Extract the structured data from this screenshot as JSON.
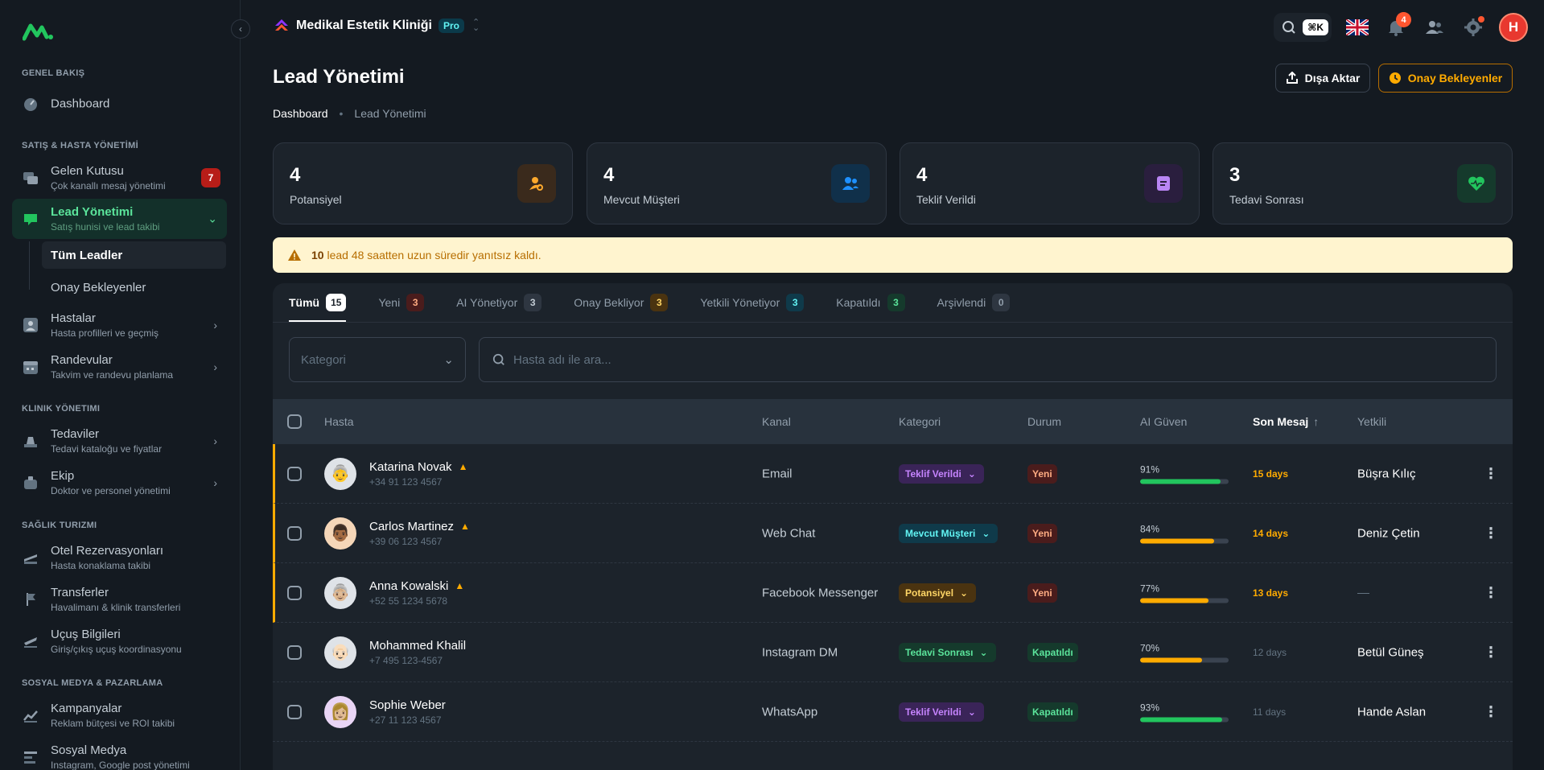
{
  "sidebar": {
    "sections": {
      "overview": "GENEL BAKIŞ",
      "sales": "SATIŞ & HASTA YÖNETİMİ",
      "clinic": "KLINIK YÖNETIMI",
      "health": "SAĞLIK TURIZMI",
      "social": "SOSYAL MEDYA & PAZARLAMA"
    },
    "items": {
      "dashboard": {
        "label": "Dashboard"
      },
      "inbox": {
        "label": "Gelen Kutusu",
        "sub": "Çok kanallı mesaj yönetimi",
        "badge": "7"
      },
      "leads": {
        "label": "Lead Yönetimi",
        "sub": "Satış hunisi ve lead takibi"
      },
      "all_leads": {
        "label": "Tüm Leadler"
      },
      "pending": {
        "label": "Onay Bekleyenler"
      },
      "patients": {
        "label": "Hastalar",
        "sub": "Hasta profilleri ve geçmiş"
      },
      "appointments": {
        "label": "Randevular",
        "sub": "Takvim ve randevu planlama"
      },
      "treatments": {
        "label": "Tedaviler",
        "sub": "Tedavi kataloğu ve fiyatlar"
      },
      "team": {
        "label": "Ekip",
        "sub": "Doktor ve personel yönetimi"
      },
      "hotels": {
        "label": "Otel Rezervasyonları",
        "sub": "Hasta konaklama takibi"
      },
      "transfers": {
        "label": "Transferler",
        "sub": "Havalimanı & klinik transferleri"
      },
      "flights": {
        "label": "Uçuş Bilgileri",
        "sub": "Giriş/çıkış uçuş koordinasyonu"
      },
      "campaigns": {
        "label": "Kampanyalar",
        "sub": "Reklam bütçesi ve ROI takibi"
      },
      "social": {
        "label": "Sosyal Medya",
        "sub": "Instagram, Google post yönetimi"
      }
    }
  },
  "header": {
    "workspace": "Medikal Estetik Kliniği",
    "plan": "Pro",
    "shortcut": "⌘K",
    "notifications": "4",
    "user_initial": "H"
  },
  "page": {
    "title": "Lead Yönetimi",
    "export_label": "Dışa Aktar",
    "pending_label": "Onay Bekleyenler",
    "breadcrumb": [
      "Dashboard",
      "Lead Yönetimi"
    ]
  },
  "stats": [
    {
      "value": "4",
      "label": "Potansiyel"
    },
    {
      "value": "4",
      "label": "Mevcut Müşteri"
    },
    {
      "value": "4",
      "label": "Teklif Verildi"
    },
    {
      "value": "3",
      "label": "Tedavi Sonrası"
    }
  ],
  "alert": {
    "count": "10",
    "text": "lead 48 saatten uzun süredir yanıtsız kaldı."
  },
  "tabs": [
    {
      "label": "Tümü",
      "count": "15"
    },
    {
      "label": "Yeni",
      "count": "3"
    },
    {
      "label": "AI Yönetiyor",
      "count": "3"
    },
    {
      "label": "Onay Bekliyor",
      "count": "3"
    },
    {
      "label": "Yetkili Yönetiyor",
      "count": "3"
    },
    {
      "label": "Kapatıldı",
      "count": "3"
    },
    {
      "label": "Arşivlendi",
      "count": "0"
    }
  ],
  "filters": {
    "category_placeholder": "Kategori",
    "search_placeholder": "Hasta adı ile ara..."
  },
  "table": {
    "columns": {
      "patient": "Hasta",
      "channel": "Kanal",
      "category": "Kategori",
      "status": "Durum",
      "ai": "AI Güven",
      "last": "Son Mesaj",
      "owner": "Yetkili"
    },
    "rows": [
      {
        "name": "Katarina Novak",
        "phone": "+34 91 123 4567",
        "channel": "Email",
        "category": "Teklif Verildi",
        "status": "Yeni",
        "ai": "91%",
        "ai_value": 91,
        "last": "15 days",
        "owner": "Büşra Kılıç"
      },
      {
        "name": "Carlos Martinez",
        "phone": "+39 06 123 4567",
        "channel": "Web Chat",
        "category": "Mevcut Müşteri",
        "status": "Yeni",
        "ai": "84%",
        "ai_value": 84,
        "last": "14 days",
        "owner": "Deniz Çetin"
      },
      {
        "name": "Anna Kowalski",
        "phone": "+52 55 1234 5678",
        "channel": "Facebook Messenger",
        "category": "Potansiyel",
        "status": "Yeni",
        "ai": "77%",
        "ai_value": 77,
        "last": "13 days",
        "owner": "—"
      },
      {
        "name": "Mohammed Khalil",
        "phone": "+7 495 123-4567",
        "channel": "Instagram DM",
        "category": "Tedavi Sonrası",
        "status": "Kapatıldı",
        "ai": "70%",
        "ai_value": 70,
        "last": "12 days",
        "owner": "Betül Güneş"
      },
      {
        "name": "Sophie Weber",
        "phone": "+27 11 123 4567",
        "channel": "WhatsApp",
        "category": "Teklif Verildi",
        "status": "Kapatıldı",
        "ai": "93%",
        "ai_value": 93,
        "last": "11 days",
        "owner": "Hande Aslan"
      }
    ]
  },
  "colors": {
    "accent": "#5be49b",
    "warning": "#ffab00",
    "danger": "#b71d18",
    "bar_green": "#22c55e",
    "bar_orange": "#ffab00"
  }
}
